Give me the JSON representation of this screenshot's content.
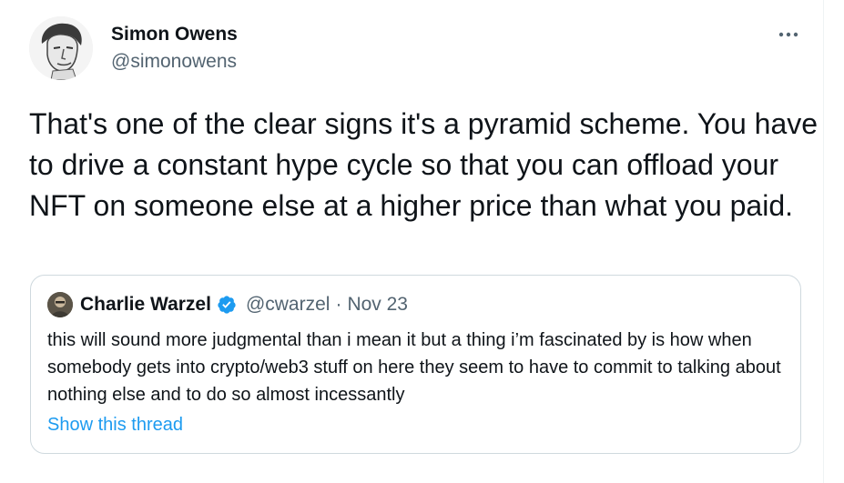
{
  "tweet": {
    "author": {
      "name": "Simon Owens",
      "handle": "@simonowens"
    },
    "more_icon": "more-horizontal-icon",
    "text": "That's one of the clear signs it's a pyramid scheme. You have to drive a constant hype cycle so that you can offload your NFT on someone else at a higher price than what you paid.",
    "quoted": {
      "name": "Charlie Warzel",
      "verified": true,
      "verified_icon": "verified-badge-icon",
      "handle": "@cwarzel",
      "separator": "·",
      "date": "Nov 23",
      "text": "this will sound more judgmental than i mean it but a thing i’m fascinated by is how when somebody gets into crypto/web3 stuff on here they seem to have to commit to talking about nothing else and to do so almost incessantly",
      "show_thread_label": "Show this thread"
    }
  },
  "colors": {
    "text_primary": "#0f1419",
    "text_secondary": "#536471",
    "accent": "#1d9bf0",
    "border": "#cfd9de"
  }
}
